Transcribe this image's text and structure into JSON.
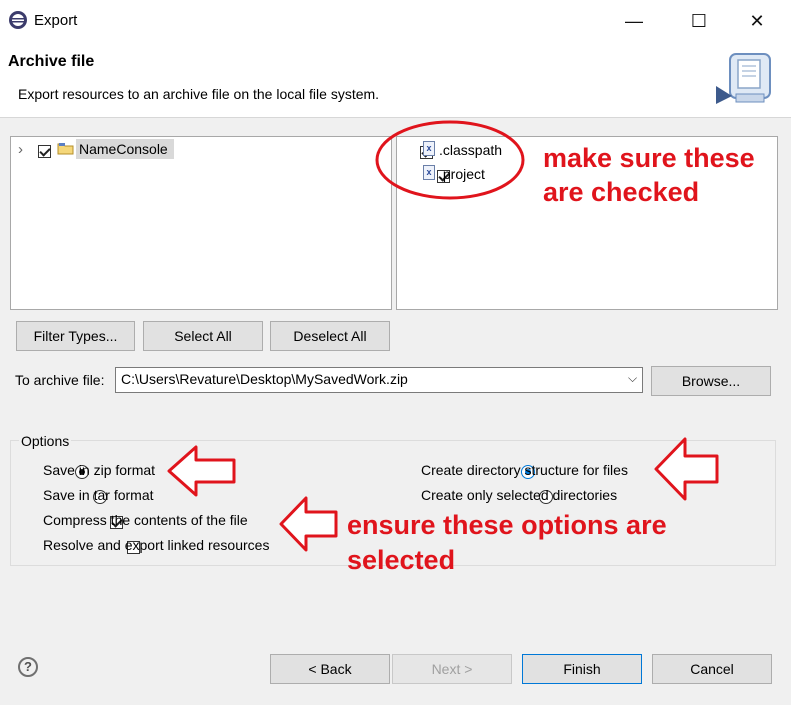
{
  "window": {
    "title": "Export",
    "minimize_glyph": "—",
    "maximize_glyph": "☐",
    "close_glyph": "✕"
  },
  "header": {
    "title": "Archive file",
    "description": "Export resources to an archive file on the local file system."
  },
  "tree": {
    "expand_glyph": "›",
    "items": [
      {
        "label": "NameConsole",
        "checked": true,
        "icon": "project-folder-icon"
      }
    ]
  },
  "files": {
    "items": [
      {
        "label": ".classpath",
        "checked": true,
        "icon": "xml-file-icon",
        "icon_glyph": "x"
      },
      {
        "label": ".project",
        "checked": true,
        "icon": "xml-file-icon",
        "icon_glyph": "x"
      }
    ]
  },
  "selection_buttons": {
    "filter_types": "Filter Types...",
    "select_all": "Select All",
    "deselect_all": "Deselect All"
  },
  "archive": {
    "label": "To archive file:",
    "value": "C:\\Users\\Revature\\Desktop\\MySavedWork.zip",
    "dropdown_glyph": "⌵",
    "browse": "Browse..."
  },
  "options": {
    "group_label": "Options",
    "zip": {
      "label": "Save in zip format",
      "selected": true
    },
    "tar": {
      "label": "Save in tar format",
      "selected": false
    },
    "compress": {
      "label": "Compress the contents of the file",
      "checked": true
    },
    "resolve": {
      "label": "Resolve and export linked resources",
      "checked": false
    },
    "create_structure": {
      "label": "Create directory structure for files",
      "selected": true
    },
    "create_selected": {
      "label": "Create only selected directories",
      "selected": false
    }
  },
  "annotations": {
    "note1_line1": "make sure these",
    "note1_line2": "are checked",
    "note2_line1": "ensure these options are",
    "note2_line2": "selected",
    "color": "#e0141c"
  },
  "footer": {
    "help_glyph": "?",
    "back": "< Back",
    "next": "Next >",
    "finish": "Finish",
    "cancel": "Cancel"
  }
}
